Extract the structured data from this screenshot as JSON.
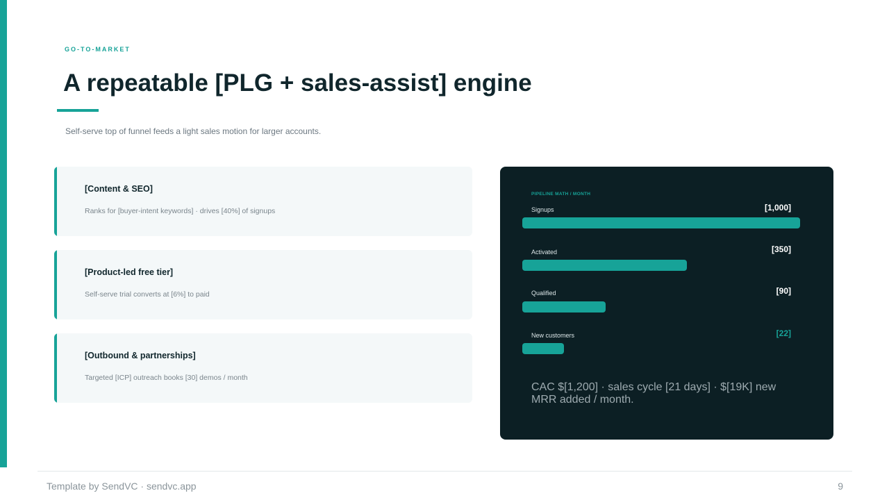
{
  "slide": {
    "eyebrow": "GO-TO-MARKET",
    "title": "A repeatable [PLG + sales-assist] engine",
    "subtitle": "Self-serve top of funnel feeds a light sales motion for larger accounts."
  },
  "channels": [
    {
      "title": "[Content & SEO]",
      "description": "Ranks for [buyer-intent keywords] · drives [40%] of signups"
    },
    {
      "title": "[Product-led free tier]",
      "description": "Self-serve trial converts at [6%] to paid"
    },
    {
      "title": "[Outbound & partnerships]",
      "description": "Targeted [ICP] outreach books [30] demos / month"
    }
  ],
  "pipeline": {
    "label": "PIPELINE MATH / MONTH",
    "max": 1000,
    "rows": [
      {
        "name": "Signups",
        "display": "[1,000]",
        "value": 1000
      },
      {
        "name": "Activated",
        "display": "[350]",
        "value": 350
      },
      {
        "name": "Qualified",
        "display": "[90]",
        "value": 90
      },
      {
        "name": "New customers",
        "display": "[22]",
        "value": 22
      }
    ],
    "note": "CAC $[1,200] · sales cycle [21 days] · $[19K] new MRR added / month."
  },
  "footer": {
    "credit": "Template by SendVC · sendvc.app",
    "page_number": "9"
  },
  "colors": {
    "accent": "#17a398",
    "panel_bg": "#0c1f24"
  }
}
